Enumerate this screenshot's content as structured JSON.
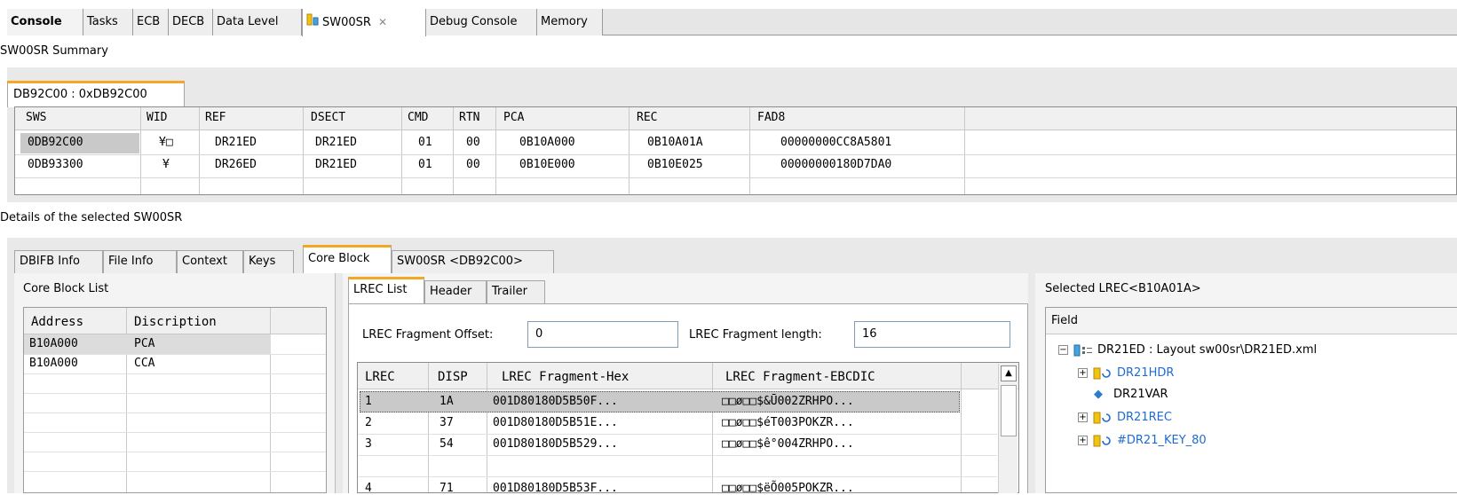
{
  "top_tabs": [
    {
      "label": "Console",
      "bold": true
    },
    {
      "label": "Tasks"
    },
    {
      "label": "ECB"
    },
    {
      "label": "DECB"
    },
    {
      "label": "Data Level"
    },
    {
      "label": "SW00SR",
      "active": true
    },
    {
      "label": "Debug Console"
    },
    {
      "label": "Memory"
    }
  ],
  "summary": {
    "title": "SW00SR Summary",
    "tab": "DB92C00 : 0xDB92C00",
    "columns": [
      "SWS",
      "WID",
      "REF",
      "DSECT",
      "CMD",
      "RTN",
      "PCA",
      "REC",
      "FAD8"
    ],
    "rows": [
      [
        "0DB92C00",
        "¥□",
        "DR21ED",
        "DR21ED",
        "01",
        "00",
        "0B10A000",
        "0B10A01A",
        "00000000CC8A5801"
      ],
      [
        "0DB93300",
        "¥",
        "DR26ED",
        "DR21ED",
        "01",
        "00",
        "0B10E000",
        "0B10E025",
        "00000000180D7DA0"
      ]
    ]
  },
  "details": {
    "title": "Details of the selected SW00SR",
    "tabs": [
      "DBIFB Info",
      "File Info",
      "Context",
      "Keys",
      "Core Block",
      "SW00SR <DB92C00>"
    ],
    "active_tab": "Core Block"
  },
  "core_block": {
    "title": "Core Block List",
    "columns": [
      "Address",
      "Discription"
    ],
    "rows": [
      [
        "B10A000",
        "PCA"
      ],
      [
        "B10A000",
        "CCA"
      ]
    ]
  },
  "lrec": {
    "tabs": [
      "LREC List",
      "Header",
      "Trailer"
    ],
    "offset_label": "LREC Fragment Offset:",
    "offset_value": "0",
    "length_label": "LREC Fragment length:",
    "length_value": "16",
    "columns": [
      "LREC",
      "DISP",
      "LREC Fragment-Hex",
      "LREC Fragment-EBCDIC"
    ],
    "rows": [
      [
        "1",
        "1A",
        "001D80180D5B50F...",
        "□□ø□□$&Ū002ZRHPO..."
      ],
      [
        "2",
        "37",
        "001D80180D5B51E...",
        "□□ø□□$éT003POKZR..."
      ],
      [
        "3",
        "54",
        "001D80180D5B529...",
        "□□ø□□$ê°004ZRHPO..."
      ],
      [
        "4",
        "71",
        "001D80180D5B53F...",
        "□□ø□□$ëÕ005POKZR..."
      ]
    ]
  },
  "selected_lrec": {
    "title": "Selected LREC<B10A01A>",
    "column": "Field",
    "root": "DR21ED : Layout sw00sr\\DR21ED.xml",
    "children": [
      "DR21HDR",
      "DR21VAR",
      "DR21REC",
      "#DR21_KEY_80"
    ]
  },
  "colors": {
    "accent_tab": "#f5a623",
    "link_blue": "#1f6bd0",
    "selected_row": "#c9c9c9"
  }
}
